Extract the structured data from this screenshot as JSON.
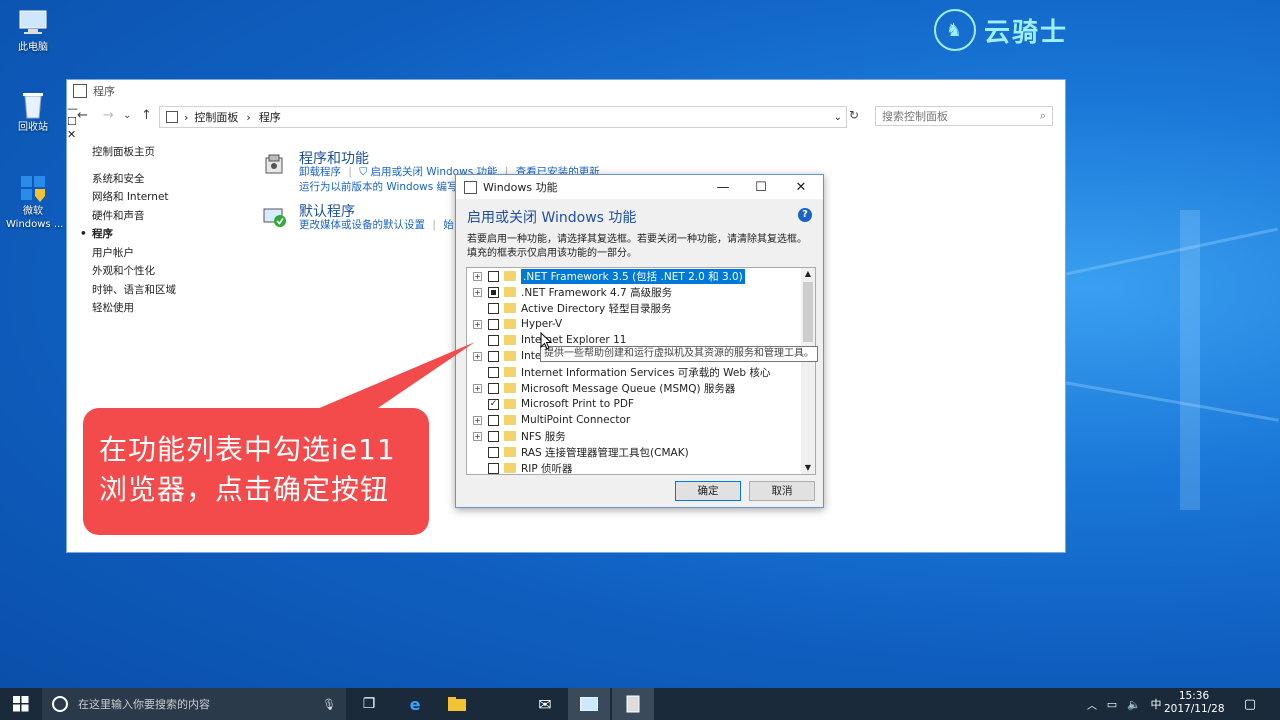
{
  "desktop": {
    "icons": [
      {
        "label": "此电脑",
        "icon": "computer-icon"
      },
      {
        "label": "回收站",
        "icon": "recycle-bin-icon"
      },
      {
        "label": "微软\nWindows ...",
        "icon": "windows-update-icon"
      }
    ],
    "brand": "云骑士"
  },
  "control_panel": {
    "title": "程序",
    "breadcrumb": [
      "控制面板",
      "程序"
    ],
    "search_placeholder": "搜索控制面板",
    "left_nav": [
      "控制面板主页",
      "系统和安全",
      "网络和 Internet",
      "硬件和声音",
      "程序",
      "用户帐户",
      "外观和个性化",
      "时钟、语言和区域",
      "轻松使用"
    ],
    "current_nav": "程序",
    "programs_and_features": {
      "heading": "程序和功能",
      "links": [
        "卸载程序",
        "启用或关闭 Windows 功能",
        "查看已安装的更新",
        "运行为以前版本的 Windows 编写"
      ]
    },
    "default_programs": {
      "heading": "默认程序",
      "links": [
        "更改媒体或设备的默认设置",
        "始"
      ]
    }
  },
  "dialog": {
    "window_title": "Windows 功能",
    "heading": "启用或关闭 Windows 功能",
    "description": "若要启用一种功能，请选择其复选框。若要关闭一种功能，请清除其复选框。填充的框表示仅启用该功能的一部分。",
    "features": [
      {
        "label": ".NET Framework 3.5 (包括 .NET 2.0 和 3.0)",
        "state": "unchecked",
        "expandable": true,
        "selected": true
      },
      {
        "label": ".NET Framework 4.7 高级服务",
        "state": "partial",
        "expandable": true
      },
      {
        "label": "Active Directory 轻型目录服务",
        "state": "unchecked",
        "expandable": false
      },
      {
        "label": "Hyper-V",
        "state": "unchecked",
        "expandable": true
      },
      {
        "label": "Internet Explorer 11",
        "state": "unchecked",
        "expandable": false
      },
      {
        "label": "Inte",
        "state": "unchecked",
        "expandable": true
      },
      {
        "label": "Internet Information Services 可承载的 Web 核心",
        "state": "unchecked",
        "expandable": false
      },
      {
        "label": "Microsoft Message Queue (MSMQ) 服务器",
        "state": "unchecked",
        "expandable": true
      },
      {
        "label": "Microsoft Print to PDF",
        "state": "checked",
        "expandable": false
      },
      {
        "label": "MultiPoint Connector",
        "state": "unchecked",
        "expandable": true
      },
      {
        "label": "NFS 服务",
        "state": "unchecked",
        "expandable": true
      },
      {
        "label": "RAS 连接管理器管理工具包(CMAK)",
        "state": "unchecked",
        "expandable": false
      },
      {
        "label": "RIP 侦听器",
        "state": "unchecked",
        "expandable": false
      }
    ],
    "tooltip": "提供一些帮助创建和运行虚拟机及其资源的服务和管理工具。",
    "ok_label": "确定",
    "cancel_label": "取消"
  },
  "callout": {
    "line1": "在功能列表中勾选ie11",
    "line2": "浏览器，点击确定按钮"
  },
  "taskbar": {
    "search_placeholder": "在这里输入你要搜索的内容",
    "ime": "中",
    "time": "15:36",
    "date": "2017/11/28"
  }
}
